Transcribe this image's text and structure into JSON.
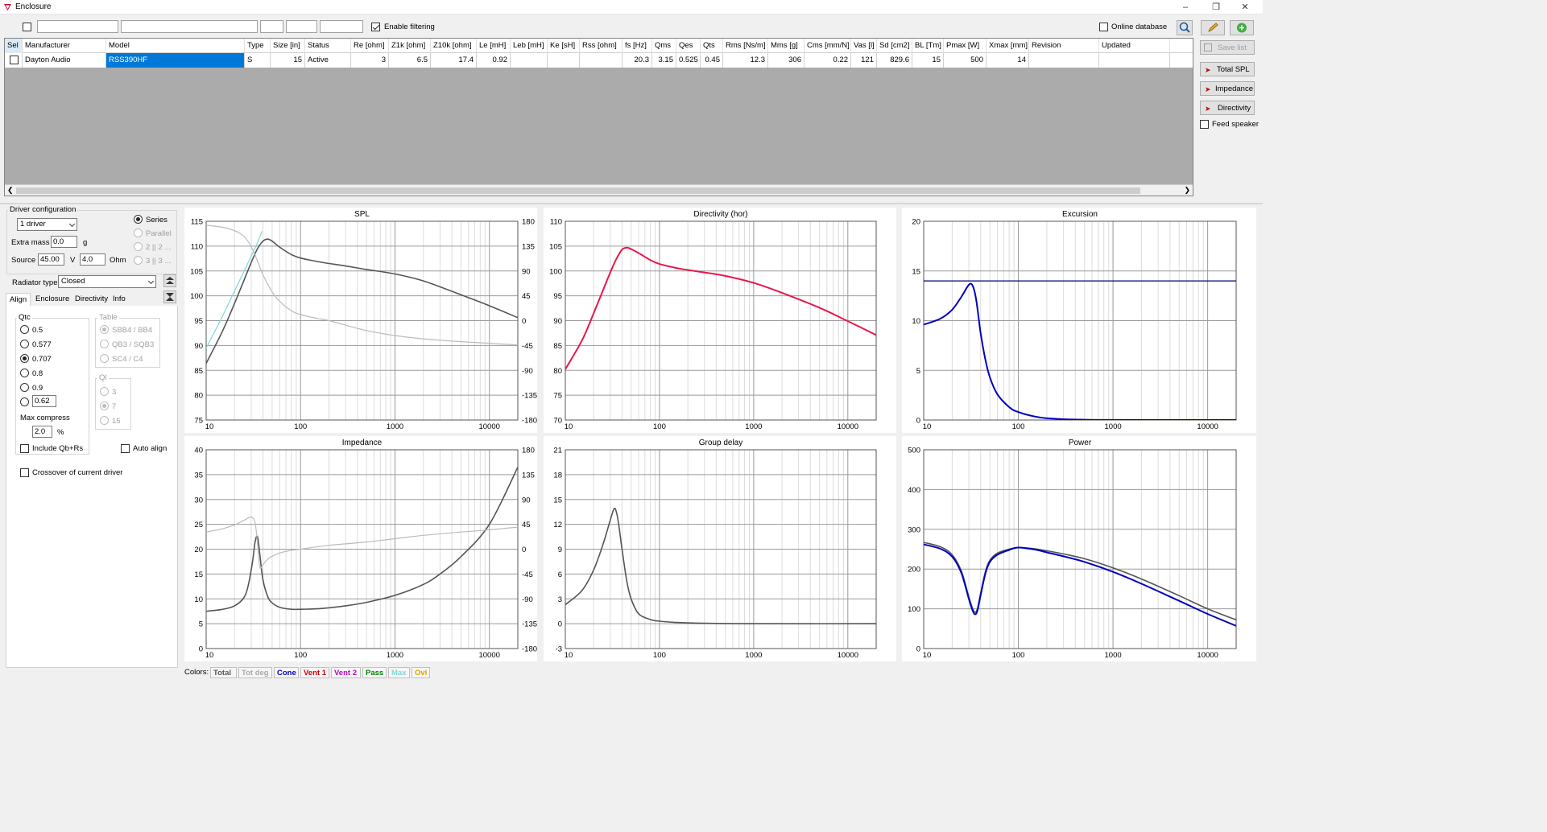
{
  "window": {
    "title": "Enclosure"
  },
  "filter_bar": {
    "enable_filtering": "Enable filtering",
    "online_database": "Online database"
  },
  "right_panel": {
    "save_list": "Save list",
    "total_spl": "Total SPL",
    "impedance": "Impedance",
    "directivity": "Directivity",
    "feed_speaker": "Feed speaker"
  },
  "grid": {
    "columns": [
      "Sel",
      "Manufacturer",
      "Model",
      "Type",
      "Size [in]",
      "Status",
      "Re [ohm]",
      "Z1k [ohm]",
      "Z10k [ohm]",
      "Le [mH]",
      "Leb [mH]",
      "Ke [sH]",
      "Rss [ohm]",
      "fs [Hz]",
      "Qms",
      "Qes",
      "Qts",
      "Rms [Ns/m]",
      "Mms [g]",
      "Cms [mm/N]",
      "Vas [l]",
      "Sd [cm2]",
      "BL [Tm]",
      "Pmax [W]",
      "Xmax [mm]",
      "Revision",
      "Updated"
    ],
    "row": [
      "",
      "Dayton Audio",
      "RSS390HF",
      "S",
      "15",
      "Active",
      "3",
      "6.5",
      "17.4",
      "0.92",
      "",
      "",
      "",
      "20.3",
      "3.15",
      "0.525",
      "0.45",
      "12.3",
      "306",
      "0.22",
      "121",
      "829.6",
      "15",
      "500",
      "14",
      "",
      ""
    ]
  },
  "left_panel": {
    "driver_configuration": "Driver configuration",
    "driver_count": "1 driver",
    "series": "Series",
    "parallel": "Parallel",
    "p22": "2 || 2 ...",
    "p33": "3 || 3 ...",
    "extra_mass_label": "Extra mass",
    "extra_mass": "0.0",
    "extra_mass_unit": "g",
    "source_label": "Source",
    "source_v": "45.00",
    "v_unit": "V",
    "source_ohm": "4.0",
    "ohm_unit": "Ohm",
    "radiator_type_label": "Radiator type",
    "radiator_type": "Closed",
    "tabs": [
      "Align",
      "Enclosure",
      "Directivity",
      "Info"
    ],
    "qtc_label": "Qtc",
    "qtc_options": [
      "0.5",
      "0.577",
      "0.707",
      "0.8",
      "0.9"
    ],
    "qtc_custom": "0.62",
    "table_label": "Table",
    "table_options": [
      "SBB4 / BB4",
      "QB3 / SQB3",
      "SC4 / C4"
    ],
    "ql_label": "Ql",
    "ql_options": [
      "3",
      "7",
      "15"
    ],
    "max_compress_label": "Max compress",
    "max_compress": "2.0",
    "max_compress_unit": "%",
    "include_qb_rs": "Include Qb+Rs",
    "auto_align": "Auto align",
    "crossover": "Crossover of current driver"
  },
  "colors_bar": {
    "label": "Colors:",
    "items": [
      {
        "name": "Total",
        "color": "#555555"
      },
      {
        "name": "Tot deg",
        "color": "#aaaaaa"
      },
      {
        "name": "Cone",
        "color": "#0000c0"
      },
      {
        "name": "Vent 1",
        "color": "#d00000"
      },
      {
        "name": "Vent 2",
        "color": "#c000c0"
      },
      {
        "name": "Pass",
        "color": "#008000"
      },
      {
        "name": "Max",
        "color": "#7fd8d8"
      },
      {
        "name": "Ovl",
        "color": "#e0a000"
      }
    ]
  },
  "chart_data": [
    {
      "type": "line",
      "title": "SPL",
      "x_ticks": [
        "10",
        "100",
        "1000",
        "10000"
      ],
      "xlim": [
        10,
        20000
      ],
      "xscale": "log",
      "ylim": [
        75,
        115
      ],
      "y_ticks": [
        "115",
        "110",
        "105",
        "100",
        "95",
        "90",
        "85",
        "80",
        "75"
      ],
      "y2lim": [
        -180,
        180
      ],
      "y2_ticks": [
        "180",
        "135",
        "90",
        "45",
        "0",
        "-45",
        "-90",
        "-135",
        "-180"
      ],
      "series": [
        {
          "color": "#555555",
          "axis": "y",
          "x": [
            10,
            15,
            20,
            25,
            30,
            35,
            40,
            45,
            50,
            60,
            80,
            100,
            150,
            200,
            300,
            500,
            1000,
            2000,
            5000,
            10000,
            20000
          ],
          "y": [
            86.4,
            93,
            98.5,
            103,
            106.7,
            109.5,
            111,
            111.4,
            111,
            109.8,
            108.3,
            107.6,
            106.9,
            106.5,
            106,
            105.3,
            104.4,
            103,
            100.2,
            98,
            95.6
          ]
        },
        {
          "color": "#bbbbbb",
          "axis": "y2",
          "x": [
            10,
            15,
            20,
            25,
            30,
            35,
            40,
            50,
            60,
            80,
            100,
            150,
            200,
            500,
            1000,
            2000,
            5000,
            10000,
            20000
          ],
          "y": [
            173,
            169,
            163,
            153,
            134,
            108,
            83,
            52,
            35,
            18,
            11,
            4,
            0,
            -18,
            -27,
            -33,
            -38,
            -41,
            -44
          ]
        },
        {
          "color": "#7fd8d8",
          "axis": "y",
          "x": [
            10,
            15,
            20,
            25,
            30,
            35,
            39
          ],
          "y": [
            89.5,
            96,
            101,
            104.8,
            108,
            110.7,
            113
          ]
        }
      ]
    },
    {
      "type": "line",
      "title": "Directivity (hor)",
      "x_ticks": [
        "10",
        "100",
        "1000",
        "10000"
      ],
      "xlim": [
        10,
        20000
      ],
      "xscale": "log",
      "ylim": [
        70,
        110
      ],
      "y_ticks": [
        "110",
        "105",
        "100",
        "95",
        "90",
        "85",
        "80",
        "75",
        "70"
      ],
      "series": [
        {
          "color": "#e8174a",
          "x": [
            10,
            15,
            20,
            25,
            30,
            35,
            40,
            45,
            50,
            60,
            80,
            100,
            150,
            200,
            300,
            500,
            1000,
            2000,
            5000,
            10000,
            20000
          ],
          "y": [
            80.2,
            86,
            91.5,
            96,
            99.7,
            102.5,
            104.3,
            104.7,
            104.4,
            103.6,
            102.2,
            101.4,
            100.6,
            100.2,
            99.7,
            99,
            97.6,
            95.6,
            92.6,
            89.9,
            87.1
          ]
        }
      ]
    },
    {
      "type": "line",
      "title": "Excursion",
      "x_ticks": [
        "10",
        "100",
        "1000",
        "10000"
      ],
      "xlim": [
        10,
        20000
      ],
      "xscale": "log",
      "ylim": [
        0,
        20
      ],
      "y_ticks": [
        "20",
        "15",
        "10",
        "5",
        "0"
      ],
      "series": [
        {
          "color": "#0000c0",
          "x": [
            10,
            15,
            20,
            25,
            30,
            33,
            36,
            40,
            45,
            50,
            60,
            80,
            100,
            150,
            200,
            300,
            500,
            1000,
            2000,
            5000,
            20000
          ],
          "y": [
            9.6,
            10.2,
            11.1,
            12.4,
            13.6,
            13.5,
            12,
            8.7,
            6,
            4.3,
            2.6,
            1.3,
            0.8,
            0.35,
            0.18,
            0.08,
            0.03,
            0.01,
            0,
            0,
            0
          ]
        },
        {
          "color": "#00007a",
          "x": [
            10,
            20000
          ],
          "y": [
            14,
            14
          ]
        }
      ]
    },
    {
      "type": "line",
      "title": "Impedance",
      "x_ticks": [
        "10",
        "100",
        "1000",
        "10000"
      ],
      "xlim": [
        10,
        20000
      ],
      "xscale": "log",
      "ylim": [
        0,
        40
      ],
      "y_ticks": [
        "40",
        "35",
        "30",
        "25",
        "20",
        "15",
        "10",
        "5",
        "0"
      ],
      "y2lim": [
        -180,
        180
      ],
      "y2_ticks": [
        "180",
        "135",
        "90",
        "45",
        "0",
        "-45",
        "-90",
        "-135",
        "-180"
      ],
      "series": [
        {
          "color": "#555555",
          "axis": "y",
          "x": [
            10,
            15,
            20,
            25,
            28,
            31,
            33,
            35,
            37,
            40,
            45,
            50,
            60,
            80,
            100,
            150,
            200,
            300,
            500,
            1000,
            2000,
            3000,
            5000,
            10000,
            20000
          ],
          "y": [
            7.5,
            7.9,
            8.6,
            10.2,
            12.8,
            17.5,
            21.5,
            22.5,
            19,
            13.8,
            10.4,
            9.2,
            8.3,
            7.9,
            7.9,
            8,
            8.2,
            8.6,
            9.3,
            10.7,
            12.9,
            15,
            18.5,
            25,
            36.5
          ]
        },
        {
          "color": "#bbbbbb",
          "axis": "y2",
          "x": [
            10,
            15,
            20,
            25,
            30,
            33,
            35,
            37,
            40,
            45,
            50,
            60,
            80,
            100,
            200,
            500,
            1000,
            2000,
            5000,
            10000,
            20000
          ],
          "y": [
            31,
            37,
            44,
            52,
            58,
            47,
            10,
            -33,
            -28,
            -18,
            -13,
            -7,
            -2,
            0,
            7,
            13,
            19,
            25,
            31,
            35,
            40
          ]
        }
      ]
    },
    {
      "type": "line",
      "title": "Group delay",
      "x_ticks": [
        "10",
        "100",
        "1000",
        "10000"
      ],
      "xlim": [
        10,
        20000
      ],
      "xscale": "log",
      "ylim": [
        -3,
        21
      ],
      "y_ticks": [
        "21",
        "18",
        "15",
        "12",
        "9",
        "6",
        "3",
        "0",
        "-3"
      ],
      "series": [
        {
          "color": "#555555",
          "x": [
            10,
            15,
            20,
            25,
            30,
            33,
            35,
            37,
            40,
            45,
            50,
            60,
            80,
            100,
            150,
            200,
            300,
            500,
            1000,
            20000
          ],
          "y": [
            2.3,
            4,
            6.5,
            9.5,
            12.5,
            13.9,
            13.4,
            11.9,
            9,
            5.1,
            3,
            1.2,
            0.5,
            0.3,
            0.15,
            0.1,
            0.05,
            0.02,
            0,
            0
          ]
        }
      ]
    },
    {
      "type": "line",
      "title": "Power",
      "x_ticks": [
        "10",
        "100",
        "1000",
        "10000"
      ],
      "xlim": [
        10,
        20000
      ],
      "xscale": "log",
      "ylim": [
        0,
        500
      ],
      "y_ticks": [
        "500",
        "400",
        "300",
        "200",
        "100",
        "0"
      ],
      "series": [
        {
          "color": "#555555",
          "x": [
            10,
            15,
            20,
            25,
            30,
            33,
            35,
            37,
            40,
            45,
            50,
            60,
            80,
            100,
            150,
            200,
            300,
            500,
            1000,
            2000,
            5000,
            10000,
            20000
          ],
          "y": [
            267,
            256,
            236,
            195,
            130,
            100,
            91,
            101,
            140,
            195,
            222,
            240,
            250,
            254,
            251,
            246,
            238,
            226,
            203,
            175,
            133,
            100,
            72
          ]
        },
        {
          "color": "#0000c0",
          "x": [
            10,
            15,
            20,
            25,
            30,
            33,
            35,
            37,
            40,
            45,
            50,
            60,
            80,
            100,
            150,
            200,
            300,
            500,
            1000,
            2000,
            5000,
            10000,
            20000
          ],
          "y": [
            262,
            251,
            231,
            190,
            125,
            95,
            86,
            96,
            135,
            190,
            218,
            236,
            248,
            254,
            249,
            242,
            232,
            218,
            193,
            163,
            120,
            87,
            57
          ]
        }
      ]
    }
  ]
}
